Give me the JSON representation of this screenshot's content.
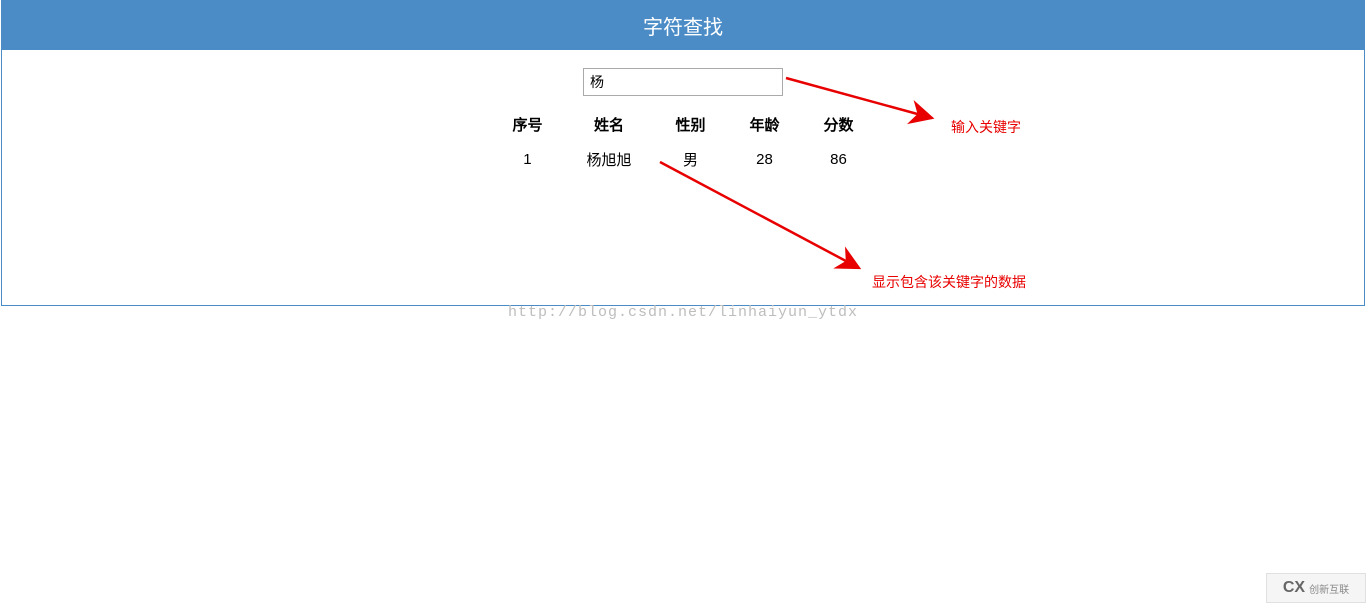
{
  "header": {
    "title": "字符查找"
  },
  "search": {
    "value": "杨"
  },
  "table": {
    "headers": [
      "序号",
      "姓名",
      "性别",
      "年龄",
      "分数"
    ],
    "rows": [
      {
        "index": "1",
        "name": "杨旭旭",
        "gender": "男",
        "age": "28",
        "score": "86"
      }
    ]
  },
  "annotations": {
    "a1": "输入关键字",
    "a2": "显示包含该关键字的数据"
  },
  "watermark": "http://blog.csdn.net/linhaiyun_ytdx",
  "logo": {
    "prefix": "CX",
    "text": "创新互联"
  }
}
